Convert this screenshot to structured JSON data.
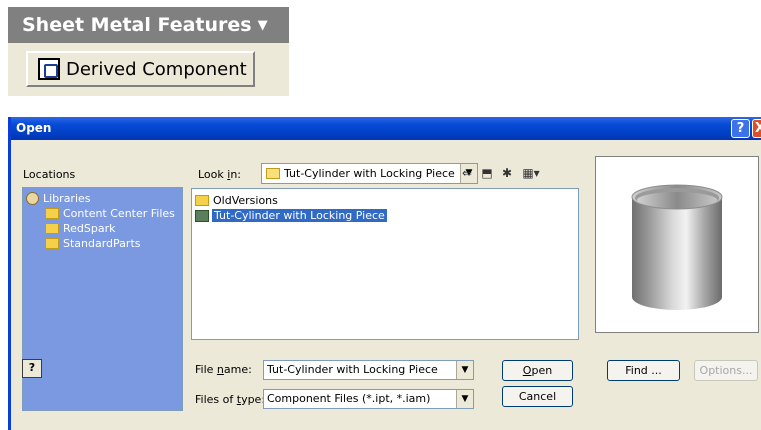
{
  "panel": {
    "title": "Sheet Metal Features",
    "derived_component_label": "Derived Component"
  },
  "dialog": {
    "title": "Open",
    "locations_label": "Locations",
    "locations": [
      {
        "label": "Libraries",
        "icon": "library-icon"
      },
      {
        "label": "Content Center Files",
        "icon": "folder-icon"
      },
      {
        "label": "RedSpark",
        "icon": "folder-icon"
      },
      {
        "label": "StandardParts",
        "icon": "folder-icon"
      }
    ],
    "look_in_label": "Look in:",
    "look_in_value": "Tut-Cylinder with Locking Piece",
    "files": [
      {
        "name": "OldVersions",
        "type": "folder"
      },
      {
        "name": "Tut-Cylinder with Locking Piece",
        "type": "part",
        "selected": true
      }
    ],
    "file_name_label": "File name:",
    "file_name_value": "Tut-Cylinder with Locking Piece",
    "files_of_type_label": "Files of type:",
    "files_of_type_value": "Component Files (*.ipt, *.iam)",
    "buttons": {
      "open": "Open",
      "cancel": "Cancel",
      "find": "Find ...",
      "options": "Options..."
    },
    "colors": {
      "titlebar": "#0a4cd8",
      "locations_pane": "#7b99e1",
      "selection": "#316ac5"
    }
  }
}
